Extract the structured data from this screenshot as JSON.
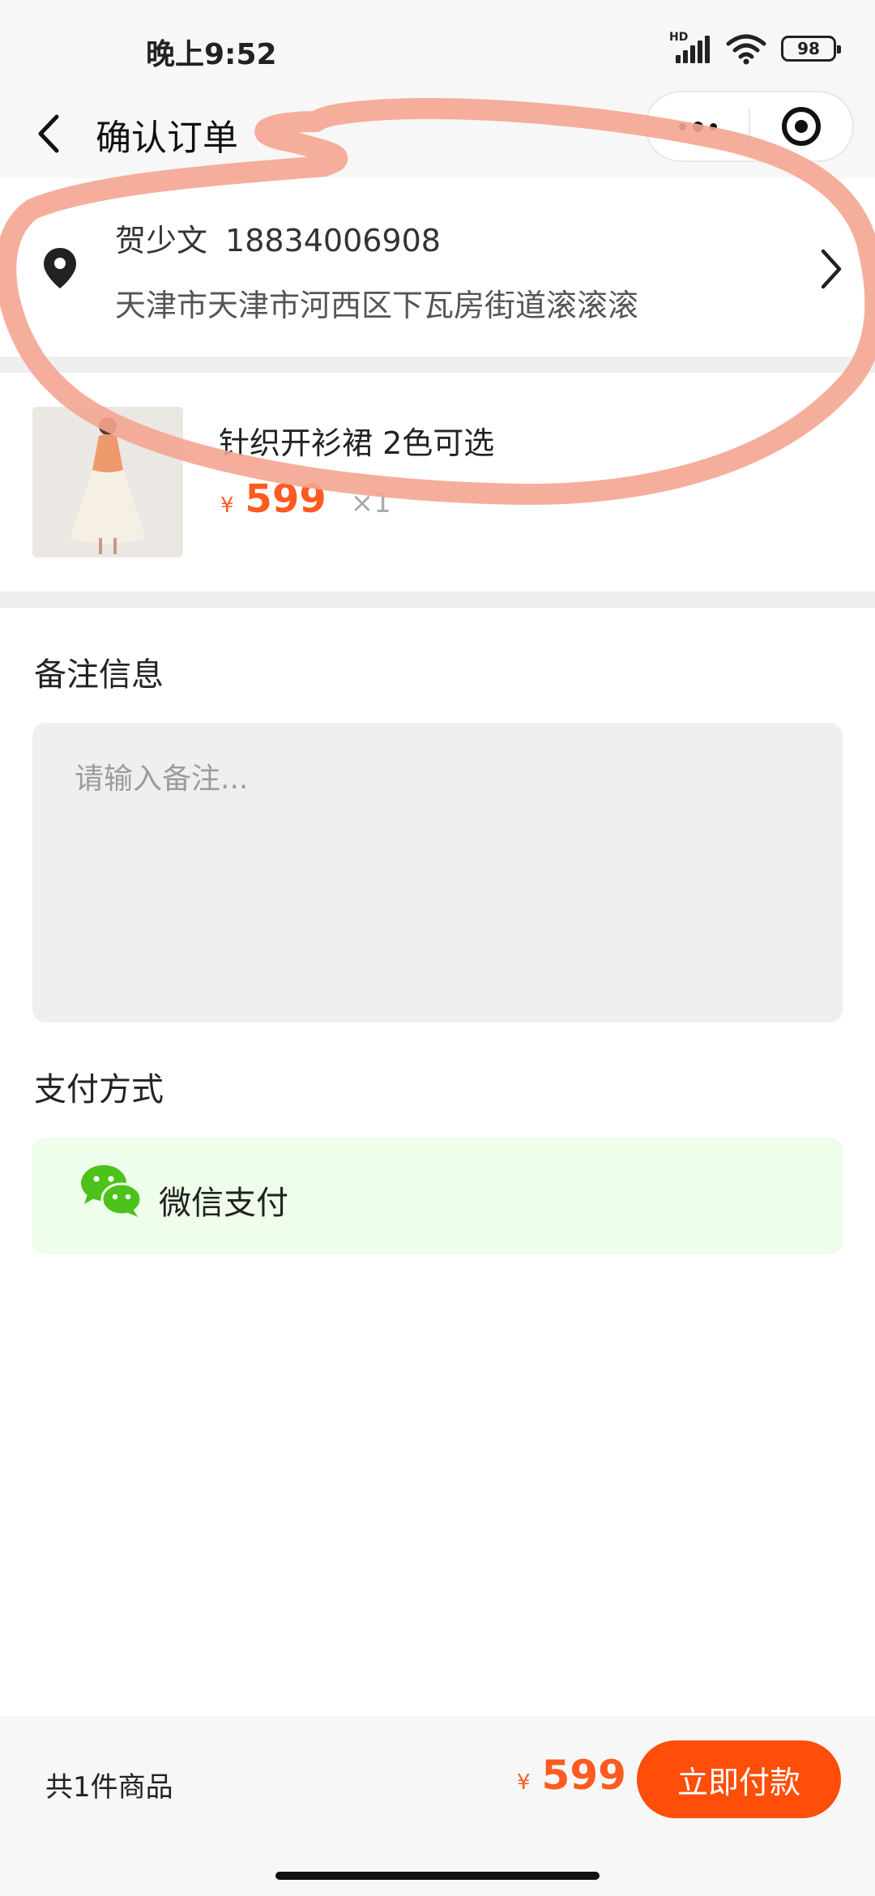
{
  "status_bar": {
    "time": "晚上9:52",
    "network_label": "HD",
    "battery": "98",
    "icons": [
      "signal-icon",
      "wifi-icon",
      "battery-icon"
    ]
  },
  "nav": {
    "title": "确认订单",
    "icons": [
      "back-icon",
      "more-icon",
      "target-icon"
    ]
  },
  "address": {
    "name": "贺少文",
    "phone": "18834006908",
    "detail": "天津市天津市河西区下瓦房街道滚滚滚"
  },
  "product": {
    "name": "针织开衫裙 2色可选",
    "currency": "¥",
    "price": "599",
    "quantity": "×1"
  },
  "remarks": {
    "title": "备注信息",
    "placeholder": "请输入备注...",
    "value": ""
  },
  "payment": {
    "title": "支付方式",
    "method": "微信支付",
    "icon": "wechat-icon"
  },
  "footer": {
    "count_label": "共1件商品",
    "currency": "¥",
    "total": "599",
    "pay_button": "立即付款"
  },
  "colors": {
    "accent": "#ff4d0a",
    "price": "#ff5a1f",
    "wechat_green": "#4cc21b",
    "pay_option_bg": "#effdeb",
    "annotation": "#f4a590"
  }
}
